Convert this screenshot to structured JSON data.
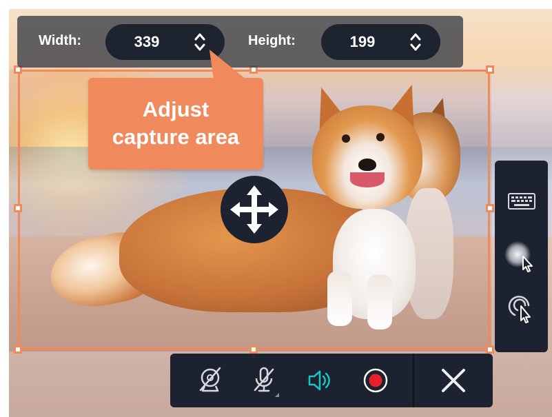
{
  "dimensions": {
    "width_label": "Width:",
    "width_value": "339",
    "height_label": "Height:",
    "height_value": "199"
  },
  "tooltip": {
    "line1": "Adjust",
    "line2": "capture area"
  },
  "icons": {
    "move": "move-arrows-icon",
    "keyboard": "keyboard-icon",
    "cursor_highlight": "cursor-highlight-icon",
    "click_effect": "click-effect-icon",
    "webcam_off": "webcam-off-icon",
    "mic_off": "microphone-off-icon",
    "speaker_on": "speaker-icon",
    "record": "record-icon",
    "close": "close-icon"
  },
  "colors": {
    "accent": "#ef8a5c",
    "toolbar_bg": "#1c2230",
    "speaker_active": "#19c7c1",
    "record_red": "#e8202a"
  }
}
